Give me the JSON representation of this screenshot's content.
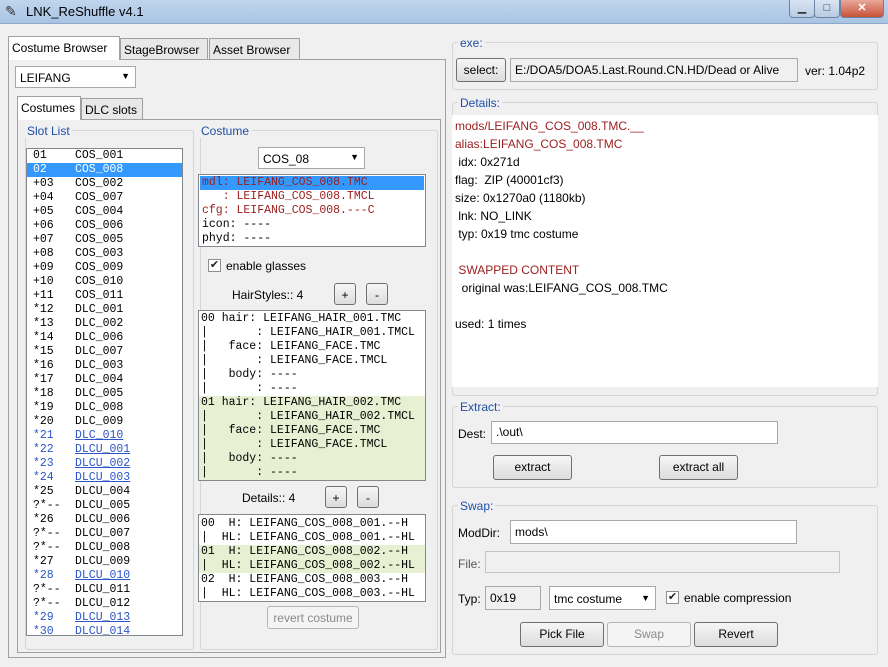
{
  "window": {
    "title": "LNK_ReShuffle v4.1"
  },
  "tabs": {
    "main": [
      "Costume Browser",
      "StageBrowser",
      "Asset Browser"
    ],
    "sub": [
      "Costumes",
      "DLC slots"
    ]
  },
  "character_select": {
    "value": "LEIFANG"
  },
  "slot_list": {
    "label": "Slot List",
    "rows": [
      {
        "prefix": "01",
        "name": "COS_001",
        "blue": false,
        "selected": false
      },
      {
        "prefix": "02",
        "name": "COS_008",
        "blue": false,
        "selected": true
      },
      {
        "prefix": "+03",
        "name": "COS_002",
        "blue": false,
        "selected": false
      },
      {
        "prefix": "+04",
        "name": "COS_007",
        "blue": false,
        "selected": false
      },
      {
        "prefix": "+05",
        "name": "COS_004",
        "blue": false,
        "selected": false
      },
      {
        "prefix": "+06",
        "name": "COS_006",
        "blue": false,
        "selected": false
      },
      {
        "prefix": "+07",
        "name": "COS_005",
        "blue": false,
        "selected": false
      },
      {
        "prefix": "+08",
        "name": "COS_003",
        "blue": false,
        "selected": false
      },
      {
        "prefix": "+09",
        "name": "COS_009",
        "blue": false,
        "selected": false
      },
      {
        "prefix": "+10",
        "name": "COS_010",
        "blue": false,
        "selected": false
      },
      {
        "prefix": "+11",
        "name": "COS_011",
        "blue": false,
        "selected": false
      },
      {
        "prefix": "*12",
        "name": "DLC_001",
        "blue": false,
        "selected": false
      },
      {
        "prefix": "*13",
        "name": "DLC_002",
        "blue": false,
        "selected": false
      },
      {
        "prefix": "*14",
        "name": "DLC_006",
        "blue": false,
        "selected": false
      },
      {
        "prefix": "*15",
        "name": "DLC_007",
        "blue": false,
        "selected": false
      },
      {
        "prefix": "*16",
        "name": "DLC_003",
        "blue": false,
        "selected": false
      },
      {
        "prefix": "*17",
        "name": "DLC_004",
        "blue": false,
        "selected": false
      },
      {
        "prefix": "*18",
        "name": "DLC_005",
        "blue": false,
        "selected": false
      },
      {
        "prefix": "*19",
        "name": "DLC_008",
        "blue": false,
        "selected": false
      },
      {
        "prefix": "*20",
        "name": "DLC_009",
        "blue": false,
        "selected": false
      },
      {
        "prefix": "*21",
        "name": "DLC_010",
        "blue": true,
        "selected": false
      },
      {
        "prefix": "*22",
        "name": "DLCU_001",
        "blue": true,
        "selected": false
      },
      {
        "prefix": "*23",
        "name": "DLCU_002",
        "blue": true,
        "selected": false
      },
      {
        "prefix": "*24",
        "name": "DLCU_003",
        "blue": true,
        "selected": false
      },
      {
        "prefix": "*25",
        "name": "DLCU_004",
        "blue": false,
        "selected": false
      },
      {
        "prefix": "?*--",
        "name": "DLCU_005",
        "blue": false,
        "selected": false
      },
      {
        "prefix": "*26",
        "name": "DLCU_006",
        "blue": false,
        "selected": false
      },
      {
        "prefix": "?*--",
        "name": "DLCU_007",
        "blue": false,
        "selected": false
      },
      {
        "prefix": "?*--",
        "name": "DLCU_008",
        "blue": false,
        "selected": false
      },
      {
        "prefix": "*27",
        "name": "DLCU_009",
        "blue": false,
        "selected": false
      },
      {
        "prefix": "*28",
        "name": "DLCU_010",
        "blue": true,
        "selected": false
      },
      {
        "prefix": "?*--",
        "name": "DLCU_011",
        "blue": false,
        "selected": false
      },
      {
        "prefix": "?*--",
        "name": "DLCU_012",
        "blue": false,
        "selected": false
      },
      {
        "prefix": "*29",
        "name": "DLCU_013",
        "blue": true,
        "selected": false
      },
      {
        "prefix": "*30",
        "name": "DLCU_014",
        "blue": true,
        "selected": false
      }
    ]
  },
  "costume": {
    "label": "Costume",
    "select_value": "COS_08",
    "files": [
      {
        "text": "mdl: LEIFANG_COS_008.TMC",
        "red": true,
        "selected": true
      },
      {
        "text": "   : LEIFANG_COS_008.TMCL",
        "red": true,
        "selected": false
      },
      {
        "text": "cfg: LEIFANG_COS_008.---C",
        "red": true,
        "selected": false
      },
      {
        "text": "icon: ----",
        "red": false,
        "selected": false
      },
      {
        "text": "phyd: ----",
        "red": false,
        "selected": false
      }
    ],
    "enable_glasses_label": "enable glasses",
    "enable_glasses_checked": true,
    "hairstyles_label": "HairStyles:: 4",
    "plus": "+",
    "minus": "-",
    "hair_lines": [
      {
        "text": "00 hair: LEIFANG_HAIR_001.TMC",
        "green": false
      },
      {
        "text": "|       : LEIFANG_HAIR_001.TMCL",
        "green": false
      },
      {
        "text": "|   face: LEIFANG_FACE.TMC",
        "green": false
      },
      {
        "text": "|       : LEIFANG_FACE.TMCL",
        "green": false
      },
      {
        "text": "|   body: ----",
        "green": false
      },
      {
        "text": "|       : ----",
        "green": false
      },
      {
        "text": "01 hair: LEIFANG_HAIR_002.TMC",
        "green": true
      },
      {
        "text": "|       : LEIFANG_HAIR_002.TMCL",
        "green": true
      },
      {
        "text": "|   face: LEIFANG_FACE.TMC",
        "green": true
      },
      {
        "text": "|       : LEIFANG_FACE.TMCL",
        "green": true
      },
      {
        "text": "|   body: ----",
        "green": true
      },
      {
        "text": "|       : ----",
        "green": true
      }
    ],
    "details_label": "Details:: 4",
    "detail_lines": [
      {
        "text": "00  H: LEIFANG_COS_008_001.--H",
        "green": false
      },
      {
        "text": "|  HL: LEIFANG_COS_008_001.--HL",
        "green": false
      },
      {
        "text": "01  H: LEIFANG_COS_008_002.--H",
        "green": true
      },
      {
        "text": "|  HL: LEIFANG_COS_008_002.--HL",
        "green": true
      },
      {
        "text": "02  H: LEIFANG_COS_008_003.--H",
        "green": false
      },
      {
        "text": "|  HL: LEIFANG_COS_008_003.--HL",
        "green": false
      }
    ],
    "revert_costume": "revert costume"
  },
  "exe": {
    "label": "exe:",
    "select_button": "select:",
    "path": "E:/DOA5/DOA5.Last.Round.CN.HD/Dead or Alive",
    "version": "ver: 1.04p2"
  },
  "details": {
    "label": "Details:",
    "lines": [
      {
        "text": "mods/LEIFANG_COS_008.TMC.__",
        "red": true
      },
      {
        "text": "alias:LEIFANG_COS_008.TMC",
        "red": true
      },
      {
        "text": " idx: 0x271d",
        "red": false
      },
      {
        "text": "flag:  ZIP (40001cf3)",
        "red": false
      },
      {
        "text": "size: 0x1270a0 (1180kb)",
        "red": false
      },
      {
        "text": " lnk: NO_LINK",
        "red": false
      },
      {
        "text": " typ: 0x19 tmc costume",
        "red": false
      },
      {
        "text": "",
        "red": false
      },
      {
        "text": " SWAPPED CONTENT",
        "red": true
      },
      {
        "text": "  original was:LEIFANG_COS_008.TMC",
        "red": false
      },
      {
        "text": "",
        "red": false
      },
      {
        "text": "used: 1 times",
        "red": false
      }
    ]
  },
  "extract": {
    "label": "Extract:",
    "dest_label": "Dest:",
    "dest_value": ".\\out\\",
    "extract_button": "extract",
    "extract_all_button": "extract all"
  },
  "swap": {
    "label": "Swap:",
    "moddir_label": "ModDir:",
    "moddir_value": "mods\\",
    "file_label": "File:",
    "file_value": "",
    "typ_label": "Typ:",
    "typ_value": "0x19",
    "type_select": "tmc costume",
    "compression_label": "enable compression",
    "compression_checked": true,
    "pick_file": "Pick File",
    "swap_button": "Swap",
    "revert_button": "Revert"
  },
  "colors": {
    "accent_label": "#1f4ea8",
    "red_text": "#9a1d1d",
    "selection": "#3399ff",
    "highlight_green": "#e7f0d2"
  }
}
